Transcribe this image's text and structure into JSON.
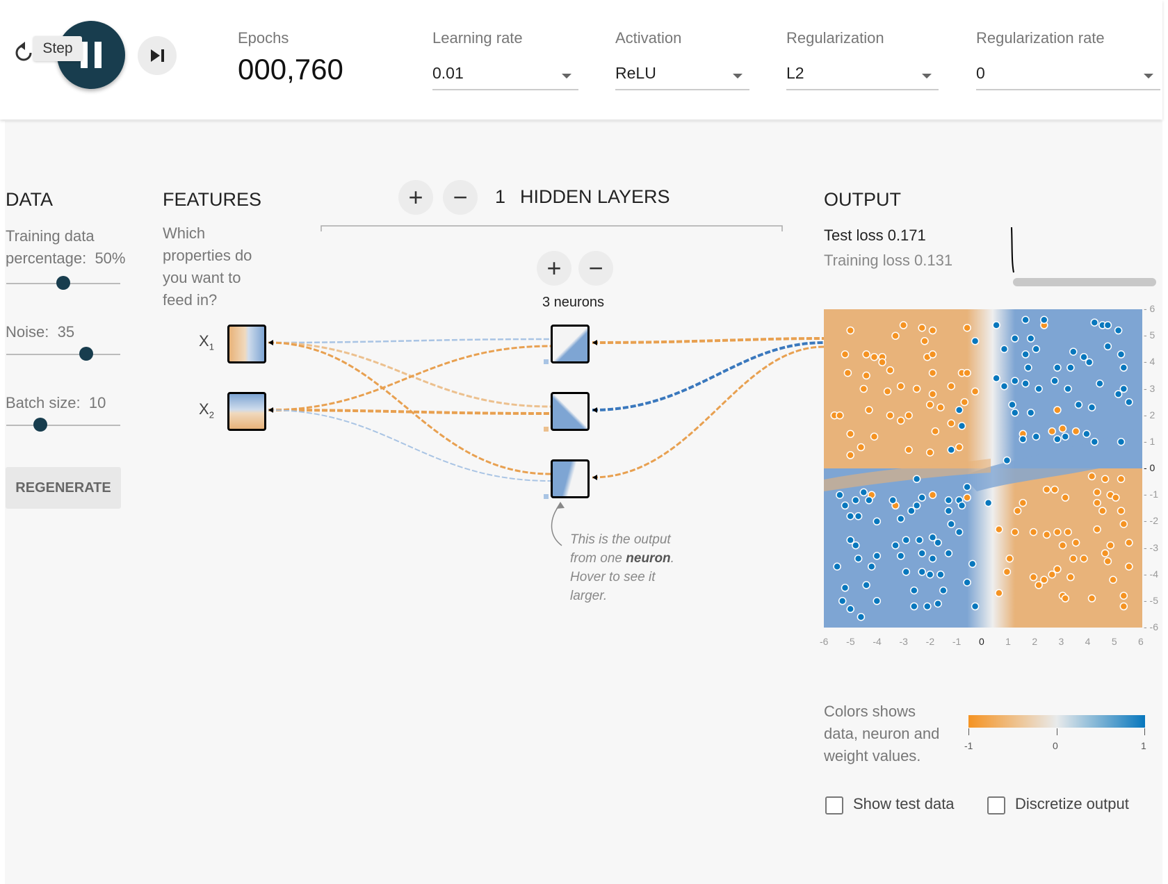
{
  "toolbar": {
    "step_tooltip": "Step",
    "epochs_label": "Epochs",
    "epochs_value": "000,760",
    "learning_rate": {
      "label": "Learning rate",
      "value": "0.01"
    },
    "activation": {
      "label": "Activation",
      "value": "ReLU"
    },
    "regularization": {
      "label": "Regularization",
      "value": "L2"
    },
    "regularization_rate": {
      "label": "Regularization rate",
      "value": "0"
    },
    "reset_icon": "reset-icon",
    "pause_icon": "pause-icon",
    "step_icon": "step-forward-icon"
  },
  "data_panel": {
    "title": "DATA",
    "training_label_1": "Training data",
    "training_label_2": "percentage:",
    "training_value": "50%",
    "training_fraction": 0.5,
    "noise_label": "Noise:",
    "noise_value": "35",
    "noise_fraction": 0.7,
    "batch_label": "Batch size:",
    "batch_value": "10",
    "batch_fraction": 0.3,
    "regenerate_label": "REGENERATE"
  },
  "features_panel": {
    "title": "FEATURES",
    "description": [
      "Which",
      "properties do",
      "you want to",
      "feed in?"
    ],
    "x1_label": "X",
    "x1_sub": "1",
    "x2_label": "X",
    "x2_sub": "2"
  },
  "network": {
    "hidden_layers_count": "1",
    "hidden_layers_label": "HIDDEN LAYERS",
    "add_layer_icon": "+",
    "remove_layer_icon": "−",
    "add_neuron_icon": "+",
    "remove_neuron_icon": "−",
    "neurons_label": "3 neurons",
    "annotation_1": "This is the output",
    "annotation_2a": "from one ",
    "annotation_2b": "neuron",
    "annotation_2c": ".",
    "annotation_3": "Hover to see it",
    "annotation_4": "larger."
  },
  "output_panel": {
    "title": "OUTPUT",
    "test_loss": "Test loss 0.171",
    "training_loss": "Training loss 0.131",
    "x_ticks": [
      "-6",
      "-5",
      "-4",
      "-3",
      "-2",
      "-1",
      "0",
      "1",
      "2",
      "3",
      "4",
      "5",
      "6"
    ],
    "y_ticks": [
      "6",
      "5",
      "4",
      "3",
      "2",
      "1",
      "0",
      "-1",
      "-2",
      "-3",
      "-4",
      "-5",
      "-6"
    ],
    "legend_text": [
      "Colors shows",
      "data, neuron and",
      "weight values."
    ],
    "legend_ticks": [
      "-1",
      "0",
      "1"
    ],
    "show_test_label": "Show test data",
    "discretize_label": "Discretize output"
  },
  "colors": {
    "orange": "#f59322",
    "blue": "#0877bd",
    "orange_fill": "#e8b37a",
    "blue_fill": "#7ea5d3",
    "dark": "#183d4e"
  },
  "chart_data": {
    "type": "scatter",
    "title": "",
    "xlabel": "",
    "ylabel": "",
    "xlim": [
      -6,
      6
    ],
    "ylim": [
      -6,
      6
    ],
    "series": [
      {
        "name": "",
        "color": "#f59322",
        "points": [
          [
            -5,
            5.2
          ],
          [
            -3,
            5.4
          ],
          [
            -2.3,
            5.3
          ],
          [
            -1.9,
            5.2
          ],
          [
            -0.6,
            5.3
          ],
          [
            -2.2,
            4.8
          ],
          [
            -3.3,
            5
          ],
          [
            -5.2,
            4.3
          ],
          [
            -4.4,
            4.3
          ],
          [
            -4.1,
            4.2
          ],
          [
            -3.8,
            4.2
          ],
          [
            -2.1,
            4.2
          ],
          [
            -1.9,
            4.3
          ],
          [
            -5.1,
            3.6
          ],
          [
            -3.8,
            4
          ],
          [
            -3.5,
            3.7
          ],
          [
            -1.9,
            3.6
          ],
          [
            -4.4,
            3.5
          ],
          [
            -0.8,
            3.6
          ],
          [
            -0.6,
            3.6
          ],
          [
            -4.5,
            3
          ],
          [
            -3.6,
            2.9
          ],
          [
            -3.1,
            3.1
          ],
          [
            -2.5,
            3
          ],
          [
            -1.2,
            3.1
          ],
          [
            -1.9,
            2.8
          ],
          [
            -0.3,
            2.9
          ],
          [
            -5.6,
            2
          ],
          [
            -5.4,
            2
          ],
          [
            -4.3,
            2.2
          ],
          [
            -3.5,
            2
          ],
          [
            -3.1,
            1.8
          ],
          [
            -2.8,
            2
          ],
          [
            -2,
            2.4
          ],
          [
            -1.6,
            2.3
          ],
          [
            -0.7,
            2.5
          ],
          [
            -5,
            1.3
          ],
          [
            -4.1,
            1.2
          ],
          [
            -1.8,
            1.4
          ],
          [
            -1.2,
            1.7
          ],
          [
            -4.6,
            0.8
          ],
          [
            -5,
            0.5
          ],
          [
            -2.8,
            0.7
          ],
          [
            -2,
            0.6
          ],
          [
            -0.9,
            0.8
          ],
          [
            -4.2,
            -1
          ],
          [
            -1.9,
            -1
          ],
          [
            -0.6,
            -1.1
          ],
          [
            -3.3,
            -1.4
          ],
          [
            2.3,
            5.4
          ],
          [
            1.5,
            1.3
          ],
          [
            2.6,
            1.4
          ],
          [
            2.8,
            2.2
          ],
          [
            3,
            1.5
          ],
          [
            3.5,
            1.4
          ],
          [
            4.1,
            -0.3
          ],
          [
            4.6,
            -0.4
          ],
          [
            5.2,
            -0.4
          ],
          [
            4.3,
            -0.9
          ],
          [
            4.8,
            -1
          ],
          [
            5,
            -1.1
          ],
          [
            2.4,
            -0.8
          ],
          [
            2.7,
            -0.8
          ],
          [
            1.5,
            -1.3
          ],
          [
            3.1,
            -1.1
          ],
          [
            4.3,
            -1.3
          ],
          [
            4.5,
            -1.6
          ],
          [
            5.2,
            -1.6
          ],
          [
            1.3,
            -1.6
          ],
          [
            0.6,
            -2.3
          ],
          [
            1.2,
            -2.4
          ],
          [
            1.9,
            -2.4
          ],
          [
            2.4,
            -2.5
          ],
          [
            2.8,
            -2.4
          ],
          [
            3.2,
            -2.4
          ],
          [
            4.3,
            -2.3
          ],
          [
            5.3,
            -2.1
          ],
          [
            3.5,
            -2.8
          ],
          [
            4.8,
            -2.9
          ],
          [
            4.6,
            -3.2
          ],
          [
            5.5,
            -2.8
          ],
          [
            3,
            -2.9
          ],
          [
            1,
            -3.4
          ],
          [
            3.4,
            -3.4
          ],
          [
            3.8,
            -3.4
          ],
          [
            5.5,
            -3.7
          ],
          [
            4.7,
            -3.5
          ],
          [
            0.9,
            -3.9
          ],
          [
            1.9,
            -4.1
          ],
          [
            2.3,
            -4.2
          ],
          [
            2.6,
            -4
          ],
          [
            2.8,
            -3.8
          ],
          [
            3.3,
            -4.1
          ],
          [
            4.9,
            -4.2
          ],
          [
            2.1,
            -4.4
          ],
          [
            3,
            -4.8
          ],
          [
            3.1,
            -4.9
          ],
          [
            4.1,
            -4.9
          ],
          [
            5.3,
            -4.8
          ],
          [
            5.3,
            -5.2
          ],
          [
            0.6,
            -4.7
          ]
        ]
      },
      {
        "name": "",
        "color": "#0877bd",
        "points": [
          [
            0.5,
            5.4
          ],
          [
            1.6,
            5.6
          ],
          [
            2.3,
            5.6
          ],
          [
            4.2,
            5.5
          ],
          [
            4.5,
            5.4
          ],
          [
            4.7,
            5.4
          ],
          [
            5.1,
            5.2
          ],
          [
            -0.3,
            4.8
          ],
          [
            0.8,
            4.5
          ],
          [
            1.2,
            4.9
          ],
          [
            1.8,
            4.9
          ],
          [
            2,
            4.5
          ],
          [
            1.6,
            4.3
          ],
          [
            3.4,
            4.4
          ],
          [
            3.8,
            4.2
          ],
          [
            4,
            4
          ],
          [
            4.7,
            4.6
          ],
          [
            5.2,
            4.3
          ],
          [
            1.7,
            3.8
          ],
          [
            2.8,
            3.8
          ],
          [
            3.3,
            3.8
          ],
          [
            5.3,
            3.8
          ],
          [
            0.5,
            3.4
          ],
          [
            0.8,
            3.1
          ],
          [
            1.2,
            3.3
          ],
          [
            1.6,
            3.2
          ],
          [
            2.1,
            3
          ],
          [
            2.7,
            3.3
          ],
          [
            3.2,
            3
          ],
          [
            4.4,
            3.2
          ],
          [
            5.3,
            3
          ],
          [
            5.1,
            2.8
          ],
          [
            1.1,
            2.4
          ],
          [
            1.2,
            2.1
          ],
          [
            1.8,
            2.1
          ],
          [
            3.6,
            2.4
          ],
          [
            4.1,
            2.3
          ],
          [
            5.5,
            2.5
          ],
          [
            -0.9,
            2.2
          ],
          [
            -0.8,
            1.6
          ],
          [
            1.5,
            1.1
          ],
          [
            2,
            1.2
          ],
          [
            2.8,
            1.1
          ],
          [
            3.1,
            1.2
          ],
          [
            3.9,
            1.3
          ],
          [
            4.2,
            1
          ],
          [
            5.2,
            1
          ],
          [
            0.9,
            0.3
          ],
          [
            -1.2,
            0.7
          ],
          [
            -2.5,
            -0.4
          ],
          [
            -5.4,
            -1
          ],
          [
            -4.5,
            -0.9
          ],
          [
            -4.8,
            -1.2
          ],
          [
            -4.3,
            -1.2
          ],
          [
            -1.3,
            -1.2
          ],
          [
            -0.9,
            -1.2
          ],
          [
            -5.2,
            -1.4
          ],
          [
            -3.4,
            -1.2
          ],
          [
            -2.3,
            -1.1
          ],
          [
            -0.6,
            -0.7
          ],
          [
            0.2,
            -1.3
          ],
          [
            -5,
            -1.8
          ],
          [
            -4.7,
            -1.8
          ],
          [
            -3.1,
            -1.9
          ],
          [
            -2.7,
            -1.6
          ],
          [
            -2.5,
            -1.4
          ],
          [
            -1.3,
            -1.6
          ],
          [
            -0.8,
            -1.4
          ],
          [
            -1.2,
            -2.1
          ],
          [
            -4,
            -2
          ],
          [
            -5,
            -2.7
          ],
          [
            -4.8,
            -2.9
          ],
          [
            -3.3,
            -2.9
          ],
          [
            -2.9,
            -2.7
          ],
          [
            -2.4,
            -2.7
          ],
          [
            -1.9,
            -2.6
          ],
          [
            -1.7,
            -2.8
          ],
          [
            -0.9,
            -2.4
          ],
          [
            -4.7,
            -3.4
          ],
          [
            -4,
            -3.3
          ],
          [
            -3.1,
            -3.3
          ],
          [
            -2.3,
            -3.2
          ],
          [
            -1.9,
            -3.4
          ],
          [
            -1.3,
            -3.2
          ],
          [
            -0.4,
            -3.6
          ],
          [
            -5.5,
            -3.7
          ],
          [
            -4.2,
            -3.7
          ],
          [
            -2.9,
            -3.9
          ],
          [
            -2.3,
            -3.9
          ],
          [
            -2,
            -4
          ],
          [
            -1.6,
            -4
          ],
          [
            -0.6,
            -4.3
          ],
          [
            -5.2,
            -4.5
          ],
          [
            -4.4,
            -4.4
          ],
          [
            -2.6,
            -4.6
          ],
          [
            -1.5,
            -4.6
          ],
          [
            -4,
            -5
          ],
          [
            -5.3,
            -5
          ],
          [
            -2.1,
            -5.2
          ],
          [
            -1.7,
            -5.1
          ],
          [
            -0.3,
            -5.2
          ],
          [
            -5,
            -5.3
          ],
          [
            -4.6,
            -5.6
          ],
          [
            -2.6,
            -5.2
          ]
        ]
      }
    ]
  }
}
